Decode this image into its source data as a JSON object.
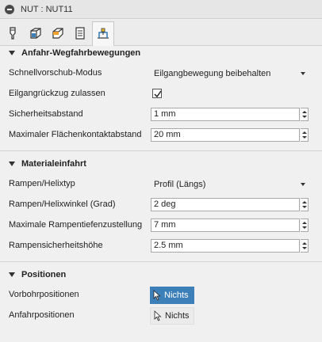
{
  "window": {
    "title": "NUT : NUT11"
  },
  "tabs": [
    {
      "icon": "tool-icon",
      "active": false
    },
    {
      "icon": "geometry-icon",
      "active": false
    },
    {
      "icon": "heights-icon",
      "active": false
    },
    {
      "icon": "passes-icon",
      "active": false
    },
    {
      "icon": "linking-icon",
      "active": true
    }
  ],
  "sections": {
    "approach": {
      "title": "Anfahr-Wegfahrbewegungen",
      "rapid_mode": {
        "label": "Schnellvorschub-Modus",
        "value": "Eilgangbewegung beibehalten"
      },
      "allow_rapid_retract": {
        "label": "Eilgangrückzug zulassen",
        "checked": true
      },
      "safe_distance": {
        "label": "Sicherheitsabstand",
        "value": "1 mm"
      },
      "max_stay_down": {
        "label": "Maximaler Flächenkontaktabstand",
        "value": "20 mm"
      }
    },
    "entry": {
      "title": "Materialeinfahrt",
      "ramp_type": {
        "label": "Rampen/Helixtyp",
        "value": "Profil (Längs)"
      },
      "ramp_angle": {
        "label": "Rampen/Helixwinkel (Grad)",
        "value": "2 deg"
      },
      "ramp_stepdown": {
        "label": "Maximale Rampentiefenzustellung",
        "value": "7 mm"
      },
      "ramp_clearance": {
        "label": "Rampensicherheitshöhe",
        "value": "2.5 mm"
      }
    },
    "positions": {
      "title": "Positionen",
      "predrill": {
        "label": "Vorbohrpositionen",
        "value": "Nichts"
      },
      "entry_positions": {
        "label": "Anfahrpositionen",
        "value": "Nichts"
      }
    }
  },
  "colors": {
    "accent": "#3d7fb8",
    "background": "#f0f0f0"
  }
}
